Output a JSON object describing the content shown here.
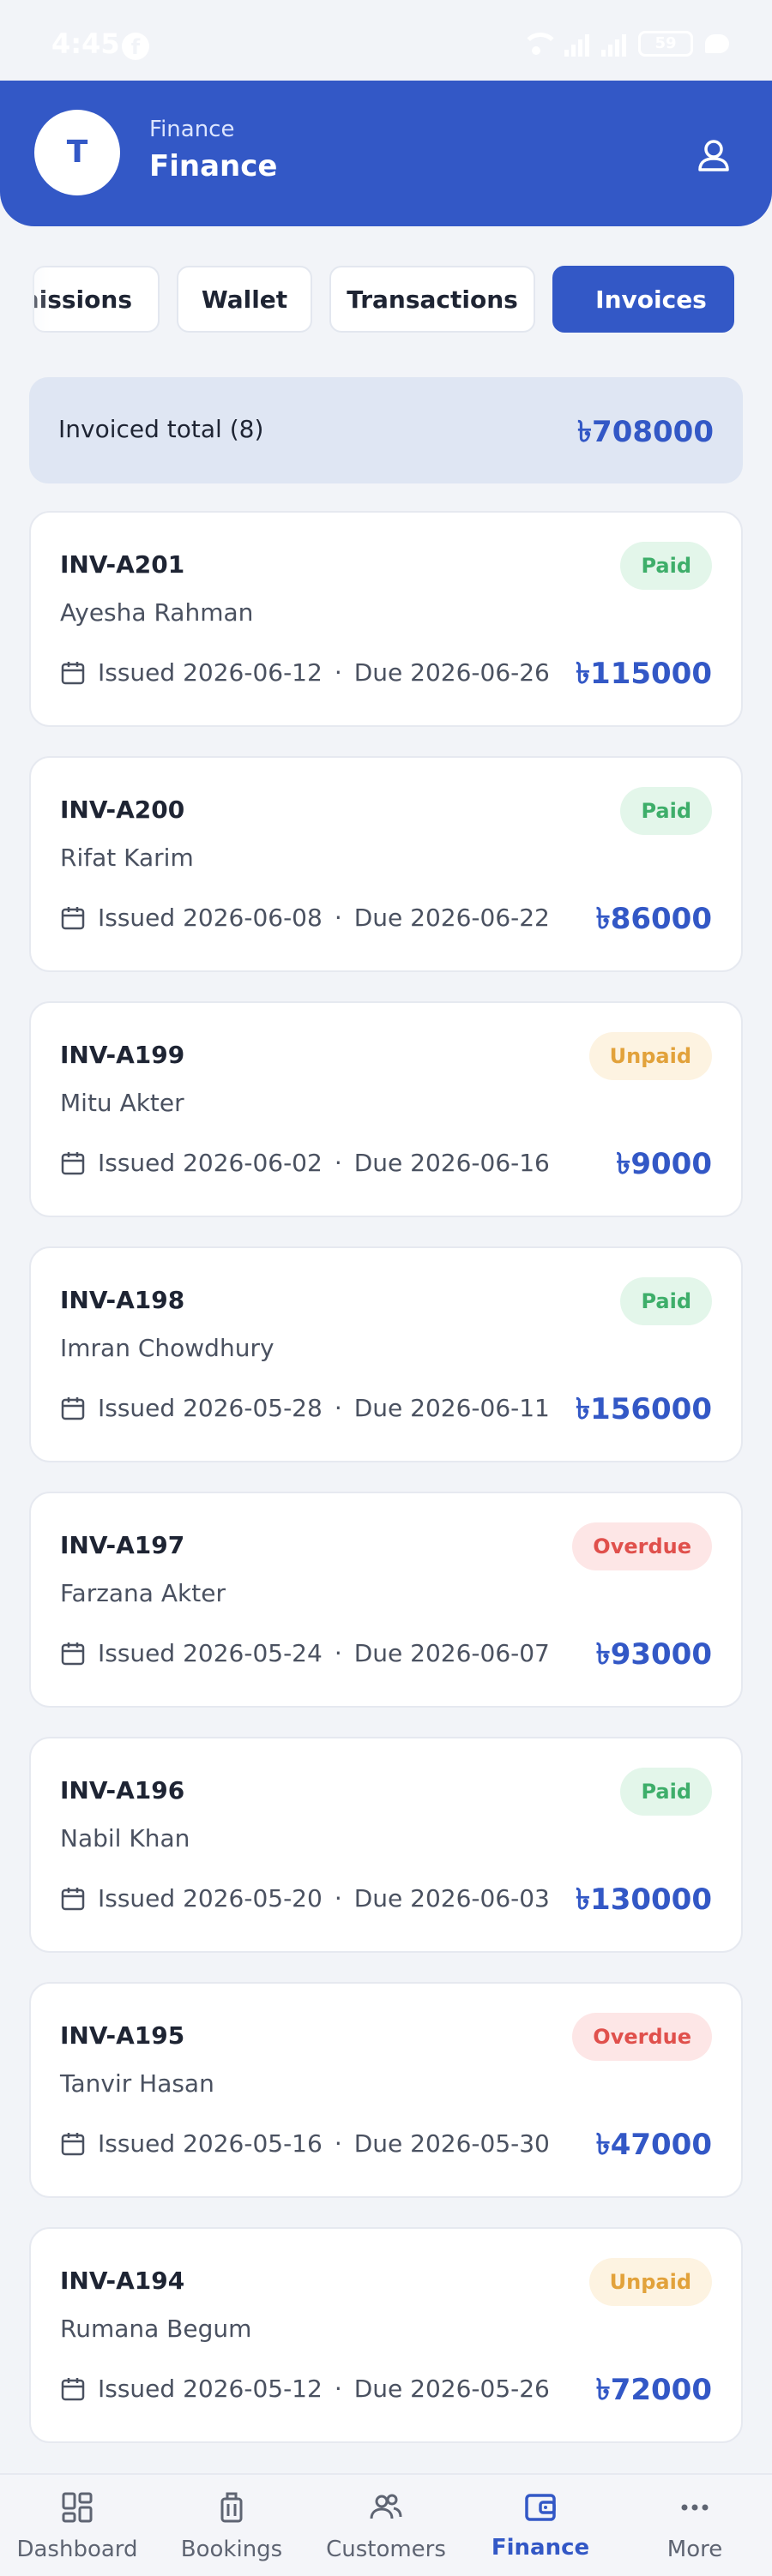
{
  "status": {
    "time": "4:45",
    "battery": "59"
  },
  "header": {
    "avatar_letter": "T",
    "subtitle": "Finance",
    "title": "Finance"
  },
  "tabs": [
    {
      "label": "missions"
    },
    {
      "label": "Wallet"
    },
    {
      "label": "Transactions"
    },
    {
      "label": "Invoices",
      "selected": true
    }
  ],
  "summary": {
    "label": "Invoiced total (8)",
    "value": "৳708000"
  },
  "invoices": [
    {
      "id": "INV-A201",
      "customer": "Ayesha Rahman",
      "status": "Paid",
      "issued": "Issued 2026-06-12",
      "due": "Due 2026-06-26",
      "amount": "৳115000"
    },
    {
      "id": "INV-A200",
      "customer": "Rifat Karim",
      "status": "Paid",
      "issued": "Issued 2026-06-08",
      "due": "Due 2026-06-22",
      "amount": "৳86000"
    },
    {
      "id": "INV-A199",
      "customer": "Mitu Akter",
      "status": "Unpaid",
      "issued": "Issued 2026-06-02",
      "due": "Due 2026-06-16",
      "amount": "৳9000"
    },
    {
      "id": "INV-A198",
      "customer": "Imran Chowdhury",
      "status": "Paid",
      "issued": "Issued 2026-05-28",
      "due": "Due 2026-06-11",
      "amount": "৳156000"
    },
    {
      "id": "INV-A197",
      "customer": "Farzana Akter",
      "status": "Overdue",
      "issued": "Issued 2026-05-24",
      "due": "Due 2026-06-07",
      "amount": "৳93000"
    },
    {
      "id": "INV-A196",
      "customer": "Nabil Khan",
      "status": "Paid",
      "issued": "Issued 2026-05-20",
      "due": "Due 2026-06-03",
      "amount": "৳130000"
    },
    {
      "id": "INV-A195",
      "customer": "Tanvir Hasan",
      "status": "Overdue",
      "issued": "Issued 2026-05-16",
      "due": "Due 2026-05-30",
      "amount": "৳47000"
    },
    {
      "id": "INV-A194",
      "customer": "Rumana Begum",
      "status": "Unpaid",
      "issued": "Issued 2026-05-12",
      "due": "Due 2026-05-26",
      "amount": "৳72000"
    }
  ],
  "separator": "·",
  "bottom_nav": [
    {
      "label": "Dashboard",
      "icon": "dashboard-icon"
    },
    {
      "label": "Bookings",
      "icon": "luggage-icon"
    },
    {
      "label": "Customers",
      "icon": "people-icon"
    },
    {
      "label": "Finance",
      "icon": "wallet-icon",
      "active": true
    },
    {
      "label": "More",
      "icon": "more-icon"
    }
  ],
  "colors": {
    "primary": "#3358c6",
    "paid": "#3eae6a",
    "unpaid": "#e2a23b",
    "overdue": "#e0504c"
  }
}
